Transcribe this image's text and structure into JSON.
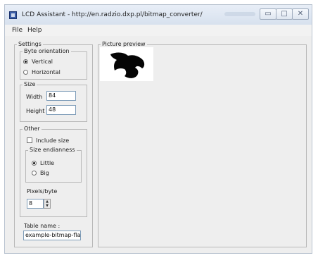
{
  "window": {
    "title": "LCD Assistant - http://en.radzio.dxp.pl/bitmap_converter/",
    "controls": {
      "minimize": "▭",
      "maximize": "□",
      "close": "✕"
    }
  },
  "menu": {
    "file": "File",
    "help": "Help"
  },
  "settings": {
    "legend": "Settings",
    "byte_orientation": {
      "legend": "Byte orientation",
      "vertical": "Vertical",
      "horizontal": "Horizontal",
      "selected": "Vertical"
    },
    "size": {
      "legend": "Size",
      "width_label": "Width",
      "width_value": "84",
      "height_label": "Height",
      "height_value": "48"
    },
    "other": {
      "legend": "Other",
      "include_size": "Include size",
      "include_size_checked": false,
      "size_endianness": {
        "legend": "Size endianness",
        "little": "Little",
        "big": "Big",
        "selected": "Little"
      },
      "pixels_per_byte_label": "Pixels/byte",
      "pixels_per_byte_value": "8"
    },
    "table_name": {
      "label": "Table name :",
      "value": "example-bitmap-fla"
    }
  },
  "preview": {
    "legend": "Picture preview"
  },
  "colors": {
    "accent": "#3d5fa8",
    "titlebar": "#dde6f1",
    "window_bg": "#eeeeee"
  }
}
